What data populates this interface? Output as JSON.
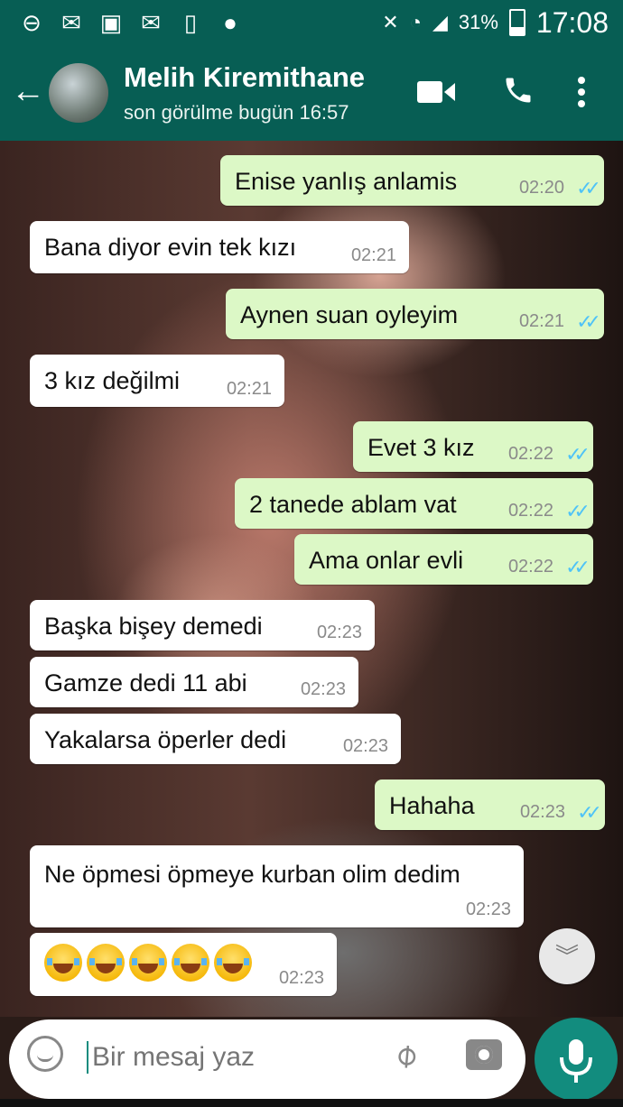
{
  "status_bar": {
    "battery": "31%",
    "time": "17:08"
  },
  "app_bar": {
    "contact_name": "Melih Kiremithane",
    "last_seen": "son görülme bugün 16:57"
  },
  "messages": [
    {
      "dir": "out",
      "text": "Enise yanlış anlamis",
      "time": "02:20"
    },
    {
      "dir": "in",
      "text": "Bana diyor evin tek kızı",
      "time": "02:21"
    },
    {
      "dir": "out",
      "text": "Aynen suan oyleyim",
      "time": "02:21"
    },
    {
      "dir": "in",
      "text": "3 kız değilmi",
      "time": "02:21"
    },
    {
      "dir": "out",
      "text": "Evet 3 kız",
      "time": "02:22"
    },
    {
      "dir": "out",
      "text": "2 tanede ablam vat",
      "time": "02:22"
    },
    {
      "dir": "out",
      "text": "Ama onlar evli",
      "time": "02:22"
    },
    {
      "dir": "in",
      "text": "Başka bişey demedi",
      "time": "02:23"
    },
    {
      "dir": "in",
      "text": "Gamze dedi 11 abi",
      "time": "02:23"
    },
    {
      "dir": "in",
      "text": "Yakalarsa öperler dedi",
      "time": "02:23"
    },
    {
      "dir": "out",
      "text": "Hahaha",
      "time": "02:23"
    },
    {
      "dir": "in",
      "text": "Ne öpmesi öpmeye kurban olim dedim",
      "time": "02:23"
    },
    {
      "dir": "in",
      "text": "",
      "time": "02:23",
      "emoji_count": 5
    }
  ],
  "composer": {
    "placeholder": "Bir mesaj yaz"
  },
  "icons": {
    "back": "arrow-left-icon",
    "video": "video-call-icon",
    "call": "phone-icon",
    "menu": "more-vertical-icon",
    "emoji": "emoji-icon",
    "attach": "paperclip-icon",
    "camera": "camera-icon",
    "mic": "microphone-icon",
    "scroll": "double-chevron-down-icon"
  },
  "colors": {
    "header": "#075e54",
    "outgoing_bubble": "#dcf8c6",
    "incoming_bubble": "#ffffff",
    "read_ticks": "#4fc3f7",
    "mic_button": "#128c7e"
  }
}
